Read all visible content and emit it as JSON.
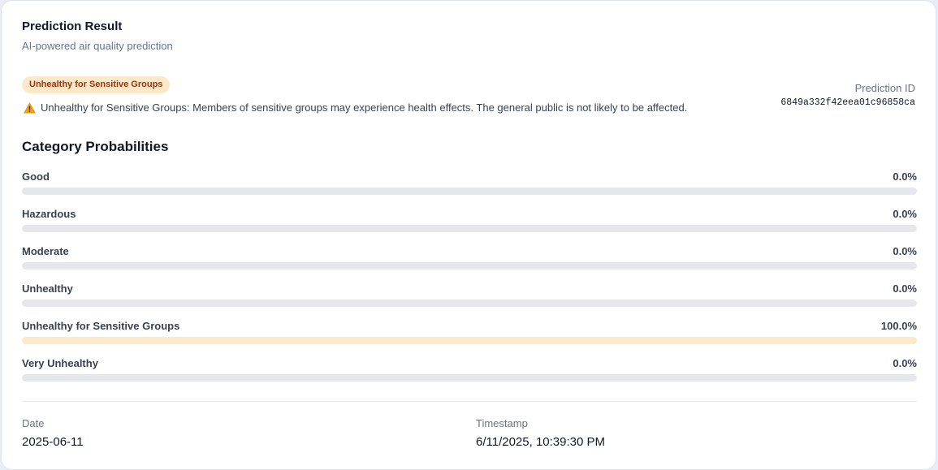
{
  "header": {
    "title": "Prediction Result",
    "subtitle": "AI-powered air quality prediction"
  },
  "status": {
    "badge": "Unhealthy for Sensitive Groups",
    "badge_color": "#fde9c8",
    "badge_text_color": "#9a3412",
    "icon": "warning-icon",
    "message": "Unhealthy for Sensitive Groups: Members of sensitive groups may experience health effects. The general public is not likely to be affected."
  },
  "prediction": {
    "id_label": "Prediction ID",
    "id_value": "6849a332f42eea01c96858ca"
  },
  "probabilities": {
    "title": "Category Probabilities",
    "items": [
      {
        "label": "Good",
        "value": "0.0%",
        "fraction": 0.0
      },
      {
        "label": "Hazardous",
        "value": "0.0%",
        "fraction": 0.0
      },
      {
        "label": "Moderate",
        "value": "0.0%",
        "fraction": 0.0
      },
      {
        "label": "Unhealthy",
        "value": "0.0%",
        "fraction": 0.0
      },
      {
        "label": "Unhealthy for Sensitive Groups",
        "value": "100.0%",
        "fraction": 1.0
      },
      {
        "label": "Very Unhealthy",
        "value": "0.0%",
        "fraction": 0.0
      }
    ]
  },
  "meta": {
    "date_label": "Date",
    "date_value": "2025-06-11",
    "timestamp_label": "Timestamp",
    "timestamp_value": "6/11/2025, 10:39:30 PM"
  }
}
